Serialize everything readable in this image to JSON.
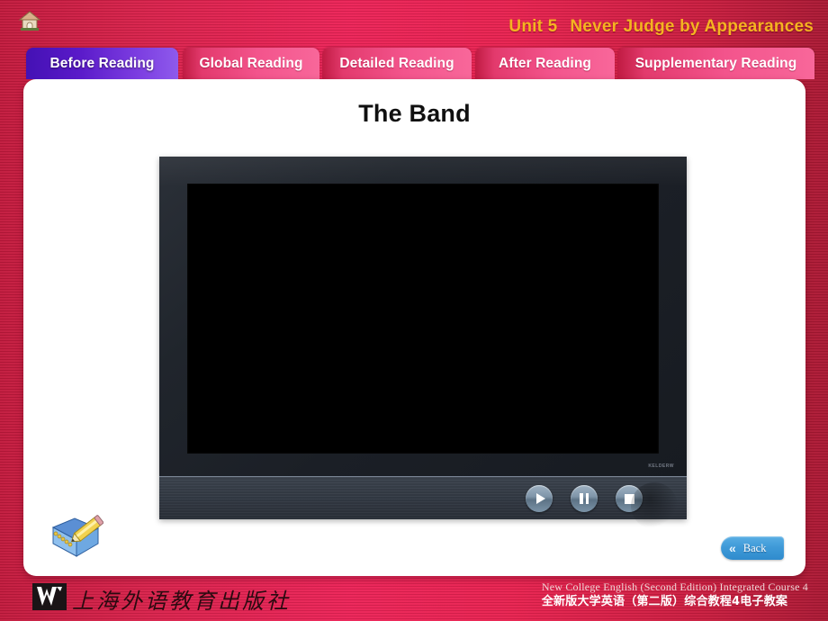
{
  "header": {
    "home_icon": "home-icon",
    "unit_number": "Unit 5",
    "unit_title": "Never Judge by Appearances",
    "title_color": "#f5b321"
  },
  "tabs": [
    {
      "label": "Before Reading",
      "active": true
    },
    {
      "label": "Global Reading",
      "active": false
    },
    {
      "label": "Detailed Reading",
      "active": false
    },
    {
      "label": "After Reading",
      "active": false
    },
    {
      "label": "Supplementary Reading",
      "active": false
    }
  ],
  "slide": {
    "title": "The Band"
  },
  "player": {
    "screen_state": "blank",
    "brand_text": "KELDERW",
    "controls": [
      {
        "name": "play",
        "icon": "play-icon"
      },
      {
        "name": "pause",
        "icon": "pause-icon"
      },
      {
        "name": "stop",
        "icon": "stop-icon"
      }
    ]
  },
  "tools": {
    "notes_icon": "notepad-pencil-icon"
  },
  "back_button": {
    "chevron": "«",
    "label": "Back",
    "color": "#3f9ad8"
  },
  "footer": {
    "publisher_mark": "w-logo",
    "publisher_name": "上海外语教育出版社",
    "course_en": "New College English (Second Edition) Integrated Course 4",
    "course_cn": "全新版大学英语（第二版）综合教程4电子教案"
  }
}
